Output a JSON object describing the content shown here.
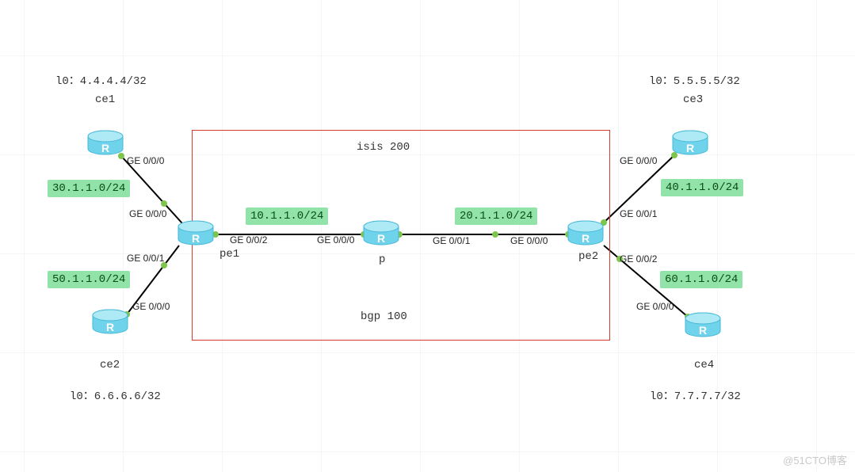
{
  "zone": {
    "proto_top": "isis 200",
    "proto_bottom": "bgp 100"
  },
  "devices": {
    "ce1": {
      "name": "ce1",
      "lo": "l0：4.4.4.4/32"
    },
    "ce2": {
      "name": "ce2",
      "lo": "l0：6.6.6.6/32"
    },
    "ce3": {
      "name": "ce3",
      "lo": "l0：5.5.5.5/32"
    },
    "ce4": {
      "name": "ce4",
      "lo": "l0：7.7.7.7/32"
    },
    "pe1": {
      "name": "pe1"
    },
    "pe2": {
      "name": "pe2"
    },
    "p": {
      "name": "p"
    }
  },
  "subnets": {
    "ce1_pe1": "30.1.1.0/24",
    "ce2_pe1": "50.1.1.0/24",
    "pe1_p": "10.1.1.0/24",
    "p_pe2": "20.1.1.0/24",
    "ce3_pe2": "40.1.1.0/24",
    "ce4_pe2": "60.1.1.0/24"
  },
  "interfaces": {
    "ce1_side": "GE 0/0/0",
    "pe1_from_ce1": "GE 0/0/0",
    "pe1_from_ce2": "GE 0/0/1",
    "ce2_side": "GE 0/0/0",
    "pe1_to_p": "GE 0/0/2",
    "p_from_pe1": "GE 0/0/0",
    "p_to_pe2": "GE 0/0/1",
    "pe2_from_p": "GE 0/0/0",
    "ce3_side": "GE 0/0/0",
    "pe2_to_ce3": "GE 0/0/1",
    "pe2_to_ce4": "GE 0/0/2",
    "ce4_side": "GE 0/0/0"
  },
  "watermark": "@51CTO博客"
}
